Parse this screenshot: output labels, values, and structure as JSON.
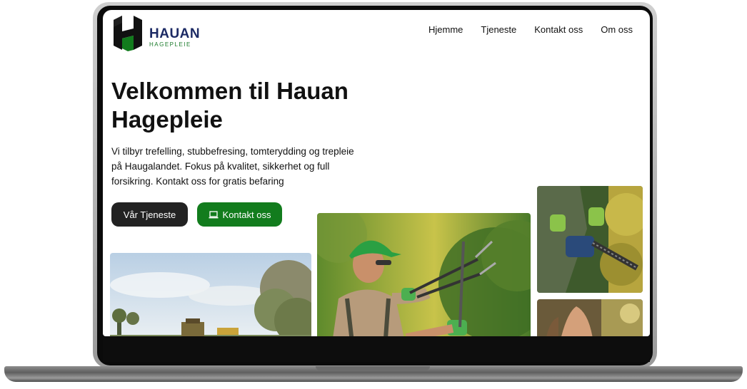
{
  "site": {
    "logo_name": "HAUAN",
    "logo_sub": "HAGEPLEIE",
    "nav": [
      "Hjemme",
      "Tjeneste",
      "Kontakt oss",
      "Om oss"
    ]
  },
  "hero": {
    "title": "Velkommen til Hauan Hagepleie",
    "text": "Vi tilbyr trefelling, stubbefresing, tomterydding og trepleie på Haugalandet. Fokus på kvalitet, sikkerhet og full forsikring. Kontakt oss for gratis befaring",
    "btn_services": "Vår Tjeneste",
    "btn_contact": "Kontakt oss"
  },
  "colors": {
    "brand_green": "#127c1d",
    "brand_navy": "#1c2a64",
    "button_dark": "#222222"
  },
  "icons": [
    "laptop-icon"
  ]
}
